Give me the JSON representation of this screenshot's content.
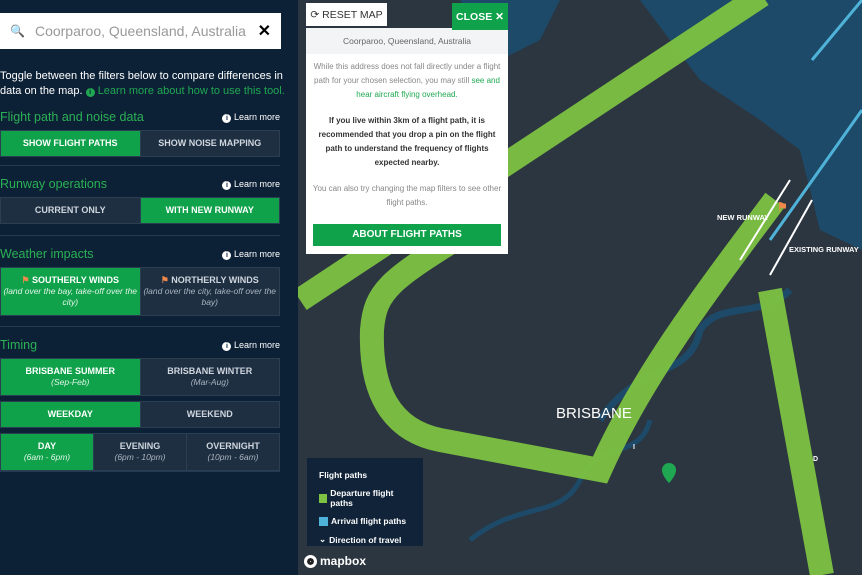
{
  "search": {
    "value": "Coorparoo, Queensland, Australia",
    "icon": "search-icon",
    "clear_icon": "close-icon"
  },
  "intro": {
    "text": "Toggle between the filters below to compare differences in data on the map.",
    "link": "Learn more about how to use this tool."
  },
  "learn_more": "Learn more",
  "sections": {
    "flight": {
      "title": "Flight path and noise data",
      "options": [
        "SHOW FLIGHT PATHS",
        "SHOW NOISE MAPPING"
      ],
      "selected": 0
    },
    "runway": {
      "title": "Runway operations",
      "options": [
        "CURRENT ONLY",
        "WITH NEW RUNWAY"
      ],
      "selected": 1
    },
    "weather": {
      "title": "Weather impacts",
      "options": [
        {
          "label": "SOUTHERLY WINDS",
          "sub": "(land over the bay, take-off over the city)"
        },
        {
          "label": "NORTHERLY WINDS",
          "sub": "(land over the city, take-off over the bay)"
        }
      ],
      "selected": 0
    },
    "timing": {
      "title": "Timing",
      "season": [
        {
          "label": "BRISBANE SUMMER",
          "sub": "(Sep-Feb)"
        },
        {
          "label": "BRISBANE WINTER",
          "sub": "(Mar-Aug)"
        }
      ],
      "week": [
        "WEEKDAY",
        "WEEKEND"
      ],
      "time": [
        {
          "label": "DAY",
          "sub": "(6am - 6pm)"
        },
        {
          "label": "EVENING",
          "sub": "(6pm - 10pm)"
        },
        {
          "label": "OVERNIGHT",
          "sub": "(10pm - 6am)"
        }
      ]
    }
  },
  "map": {
    "reset": "RESET MAP",
    "close": "CLOSE ✕",
    "popup": {
      "address": "Coorparoo, Queensland, Australia",
      "p1": "While this address does not fall directly under a flight path for your chosen selection, you may still",
      "p1_link": "see and hear aircraft flying overhead.",
      "p2": "If you live within 3km of a flight path, it is recommended that you drop a pin on the flight path to understand the frequency of flights expected nearby.",
      "p3": "You can also try changing the map filters to see other flight paths.",
      "button": "ABOUT FLIGHT PATHS"
    },
    "labels": {
      "city": "BRISBANE",
      "new_runway": "NEW RUNWAY",
      "existing_runway": "EXISTING RUNWAY",
      "path_i": "I",
      "path_d": "D"
    },
    "legend": {
      "title": "Flight paths",
      "departure": "Departure flight paths",
      "arrival": "Arrival flight paths",
      "direction": "Direction of travel"
    },
    "attribution": "mapbox",
    "colors": {
      "departure": "#7dc242",
      "arrival": "#4fb3d9",
      "accent": "#0fa24a"
    }
  }
}
